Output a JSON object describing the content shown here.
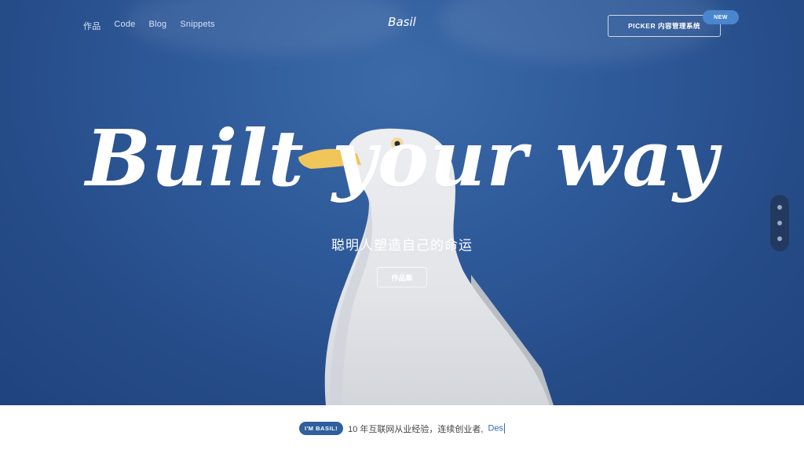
{
  "nav": {
    "items": [
      "作品",
      "Code",
      "Blog",
      "Snippets"
    ]
  },
  "brand": {
    "name": "Basil"
  },
  "header_cta": {
    "label": "PICKER 内容管理系统",
    "badge": "NEW"
  },
  "hero": {
    "headline": "Built your way",
    "subtitle": "聪明人塑造自己的命运",
    "button": "作品集"
  },
  "side_nav": {
    "dots": 3
  },
  "intro": {
    "badge": "I'M BASIL!",
    "text": "10 年互联网从业经验，连续创业者, ",
    "typing": "Des"
  },
  "colors": {
    "sky": "#2f5b9b",
    "accent": "#4a86d0",
    "badge": "#2f5f9c"
  }
}
